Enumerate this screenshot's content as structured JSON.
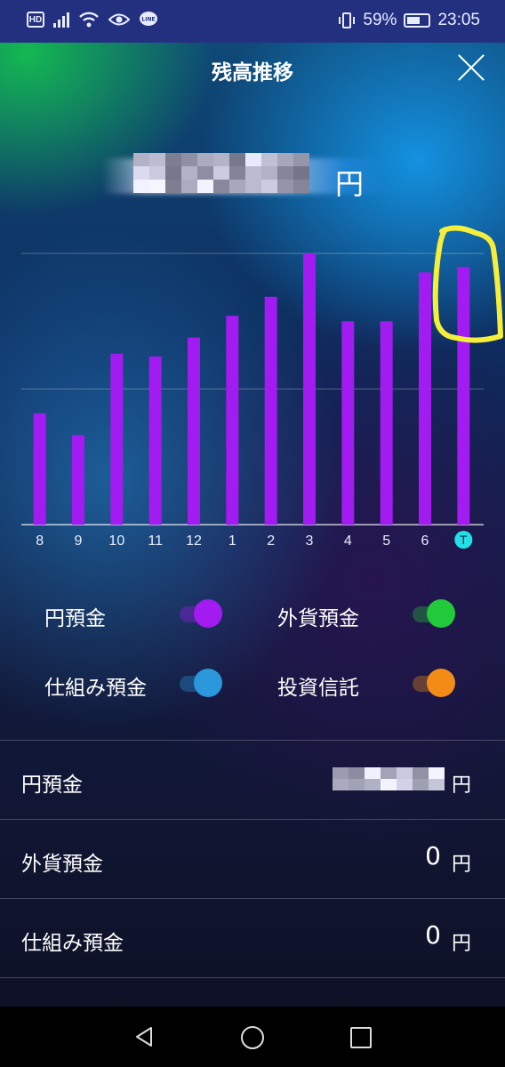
{
  "status_bar": {
    "left_icons": [
      "hd-icon",
      "signal-icon",
      "wifi-icon",
      "eye-icon",
      "line-app-icon"
    ],
    "hd_label": "HD",
    "line_label": "LINE",
    "battery_percent": "59%",
    "time": "23:05"
  },
  "header": {
    "title": "残高推移",
    "close_icon": "close-icon"
  },
  "total": {
    "amount_masked": "blurred",
    "unit": "円"
  },
  "chart_data": {
    "type": "bar",
    "categories": [
      "8",
      "9",
      "10",
      "11",
      "12",
      "1",
      "2",
      "3",
      "4",
      "5",
      "6",
      "T"
    ],
    "values": [
      41,
      33,
      63,
      62,
      69,
      77,
      84,
      100,
      75,
      75,
      93,
      95
    ],
    "ylim": [
      0,
      100
    ],
    "highlight_category": "T",
    "colors": {
      "bar": "#a21bf0",
      "highlight_badge": "#22e0e6"
    }
  },
  "toggles": [
    {
      "label": "円預金",
      "on": true,
      "color": "#a21bf0"
    },
    {
      "label": "外貨預金",
      "on": true,
      "color": "#22c93a"
    },
    {
      "label": "仕組み預金",
      "on": true,
      "color": "#2b98dc"
    },
    {
      "label": "投資信託",
      "on": true,
      "color": "#f28c17"
    }
  ],
  "rows": [
    {
      "label": "円預金",
      "value": "",
      "masked": true,
      "unit": "円"
    },
    {
      "label": "外貨預金",
      "value": "0",
      "masked": false,
      "unit": "円"
    },
    {
      "label": "仕組み預金",
      "value": "0",
      "masked": false,
      "unit": "円"
    }
  ],
  "nav": {
    "back_icon": "back-triangle-icon",
    "home_icon": "home-circle-icon",
    "recent_icon": "recent-apps-square-icon"
  },
  "annotation": {
    "color": "#f5ef3c"
  }
}
